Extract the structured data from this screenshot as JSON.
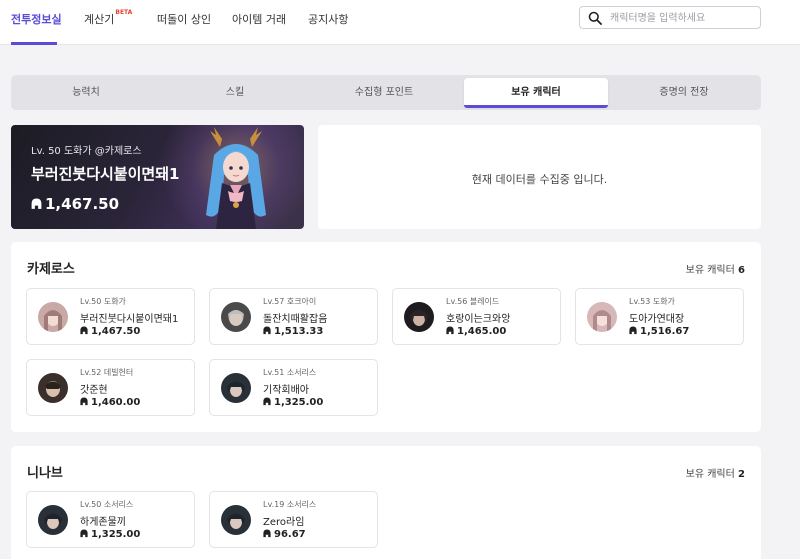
{
  "nav": {
    "items": [
      {
        "label": "전투정보실",
        "beta": ""
      },
      {
        "label": "계산기",
        "beta": "BETA"
      },
      {
        "label": "떠돌이 상인",
        "beta": ""
      },
      {
        "label": "아이템 거래",
        "beta": ""
      },
      {
        "label": "공지사항",
        "beta": ""
      }
    ],
    "active_index": 0,
    "search_placeholder": "캐릭터명을 입력하세요"
  },
  "tabs": {
    "items": [
      "능력치",
      "스킬",
      "수집형 포인트",
      "보유 캐릭터",
      "증명의 전장"
    ],
    "active_index": 3
  },
  "hero": {
    "meta": "Lv. 50 도화가 @카제로스",
    "name": "부러진붓다시붙이면돼1",
    "score": "1,467.50"
  },
  "collecting": {
    "message": "현재 데이터를 수집중 입니다."
  },
  "servers": [
    {
      "name": "카제로스",
      "count_label": "보유 캐릭터",
      "count": "6",
      "characters": [
        {
          "meta": "Lv.50 도화가",
          "name": "부러진붓다시붙이면돼1",
          "score": "1,467.50"
        },
        {
          "meta": "Lv.57 호크아이",
          "name": "돌잔치때활잡음",
          "score": "1,513.33"
        },
        {
          "meta": "Lv.56 블레이드",
          "name": "호랑이는크와앙",
          "score": "1,465.00"
        },
        {
          "meta": "Lv.53 도화가",
          "name": "도아가연대장",
          "score": "1,516.67"
        },
        {
          "meta": "Lv.52 데빌헌터",
          "name": "갓준현",
          "score": "1,460.00"
        },
        {
          "meta": "Lv.51 소서리스",
          "name": "기작회배아",
          "score": "1,325.00"
        }
      ]
    },
    {
      "name": "니나브",
      "count_label": "보유 캐릭터",
      "count": "2",
      "characters": [
        {
          "meta": "Lv.50 소서리스",
          "name": "하게존물끼",
          "score": "1,325.00"
        },
        {
          "meta": "Lv.19 소서리스",
          "name": "Zero라임",
          "score": "96.67"
        }
      ]
    }
  ],
  "colors": {
    "accent": "#5b4bd6",
    "beta": "#e8422f"
  }
}
